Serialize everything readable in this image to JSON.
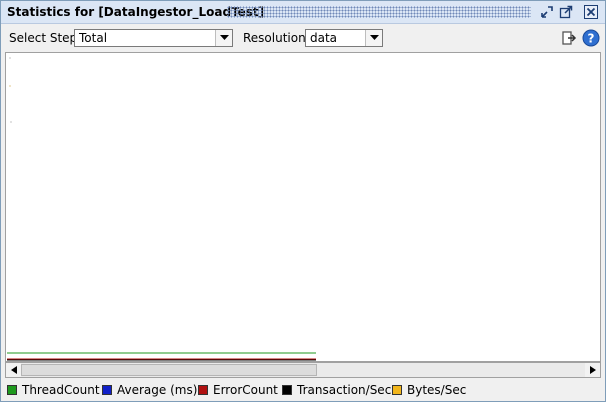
{
  "window": {
    "title": "Statistics for [DataIngestor_LoadTest]"
  },
  "toolbar": {
    "step_label": "Select Step:",
    "step_value": "Total",
    "resolution_label": "Resolution:",
    "resolution_value": "data"
  },
  "icons": {
    "restore": "restore-icon",
    "maximize": "maximize-icon",
    "close": "close-icon",
    "export": "export-icon",
    "help": "help-icon"
  },
  "legend": [
    {
      "label": "ThreadCount",
      "color": "#1f9a1f"
    },
    {
      "label": "Average (ms)",
      "color": "#1020c8"
    },
    {
      "label": "ErrorCount",
      "color": "#b01010"
    },
    {
      "label": "Transaction/Sec",
      "color": "#000000"
    },
    {
      "label": "Bytes/Sec",
      "color": "#f2b61c"
    }
  ],
  "colors": {
    "titlebar": "#dbe6f5",
    "accent_help": "#2f6fd0"
  }
}
